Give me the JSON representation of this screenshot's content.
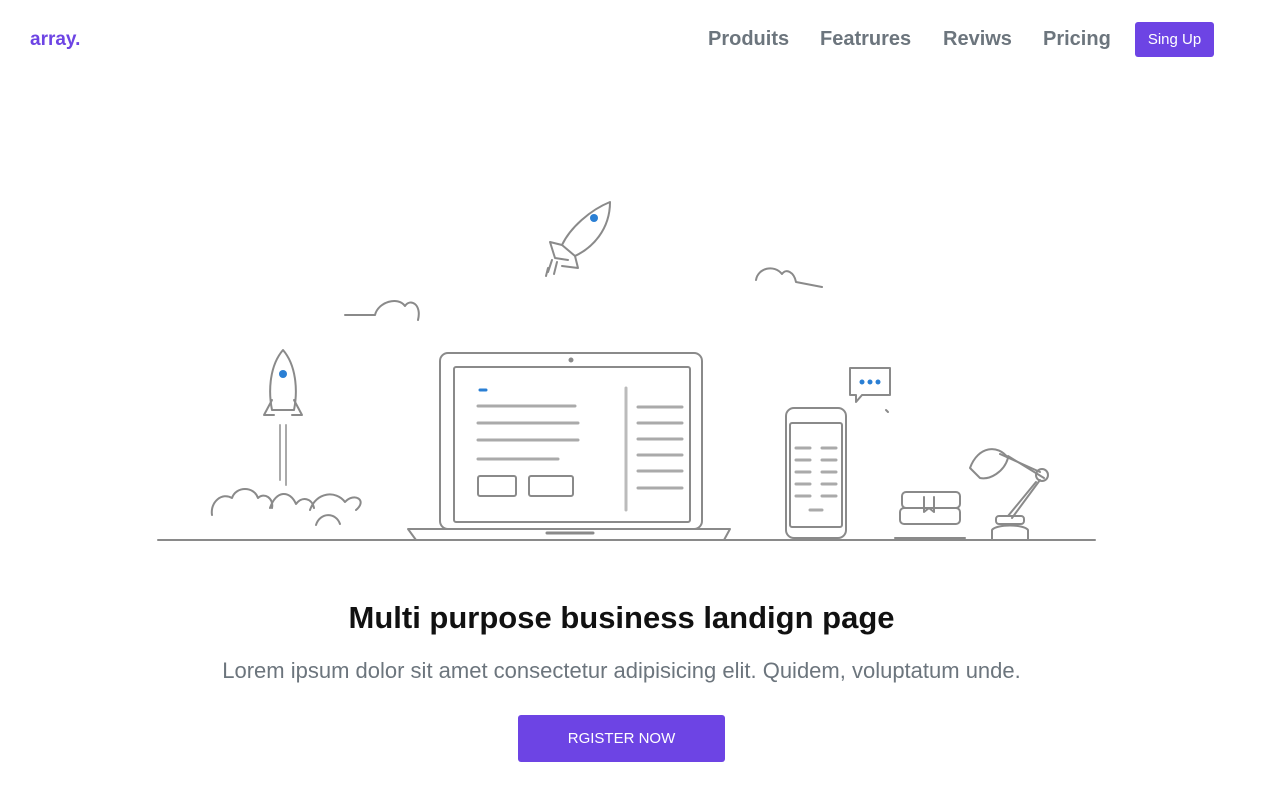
{
  "brand": "array.",
  "nav": {
    "links": [
      "Produits",
      "Featrures",
      "Reviws",
      "Pricing"
    ],
    "signup_label": "Sing Up"
  },
  "hero": {
    "title": "Multi purpose business landign page",
    "subtitle": "Lorem ipsum dolor sit amet consectetur adipisicing elit. Quidem, voluptatum unde.",
    "cta_label": "RGISTER NOW"
  },
  "colors": {
    "accent": "#6d44e4",
    "nav_text": "#6c757d",
    "illustration_dot": "#2a7fd4"
  }
}
